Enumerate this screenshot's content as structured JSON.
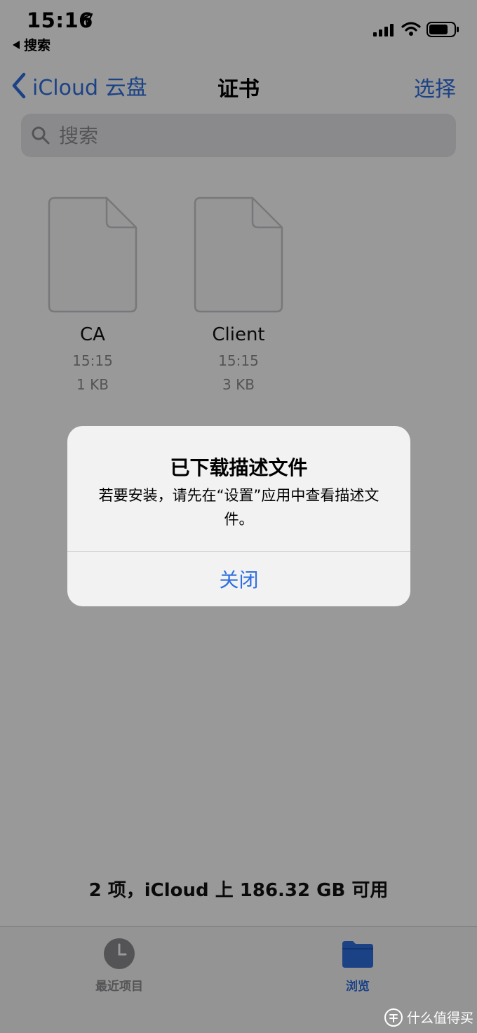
{
  "status_bar": {
    "time": "15:16",
    "back_app": "搜索",
    "icons": [
      "location-arrow-icon",
      "signal-icon",
      "wifi-icon",
      "battery-icon"
    ]
  },
  "nav": {
    "back_label": "iCloud 云盘",
    "title": "证书",
    "select_label": "选择"
  },
  "search": {
    "placeholder": "搜索"
  },
  "files": [
    {
      "name": "CA",
      "date": "15:15",
      "size": "1 KB"
    },
    {
      "name": "Client",
      "date": "15:15",
      "size": "3 KB"
    }
  ],
  "footer": {
    "item_count": "2 项，iCloud 上 186.32 GB 可用"
  },
  "tabs": [
    {
      "label": "最近项目",
      "icon": "clock-icon"
    },
    {
      "label": "浏览",
      "icon": "folder-icon"
    }
  ],
  "alert": {
    "title": "已下载描述文件",
    "message": "若要安装，请先在“设置”应用中查看描述文件。",
    "button": "关闭"
  },
  "watermark": {
    "text": "什么值得买"
  },
  "colors": {
    "accent": "#2f6fe0",
    "dim_overlay": "rgba(0,0,0,0.40)",
    "alert_bg": "#f2f2f2"
  }
}
